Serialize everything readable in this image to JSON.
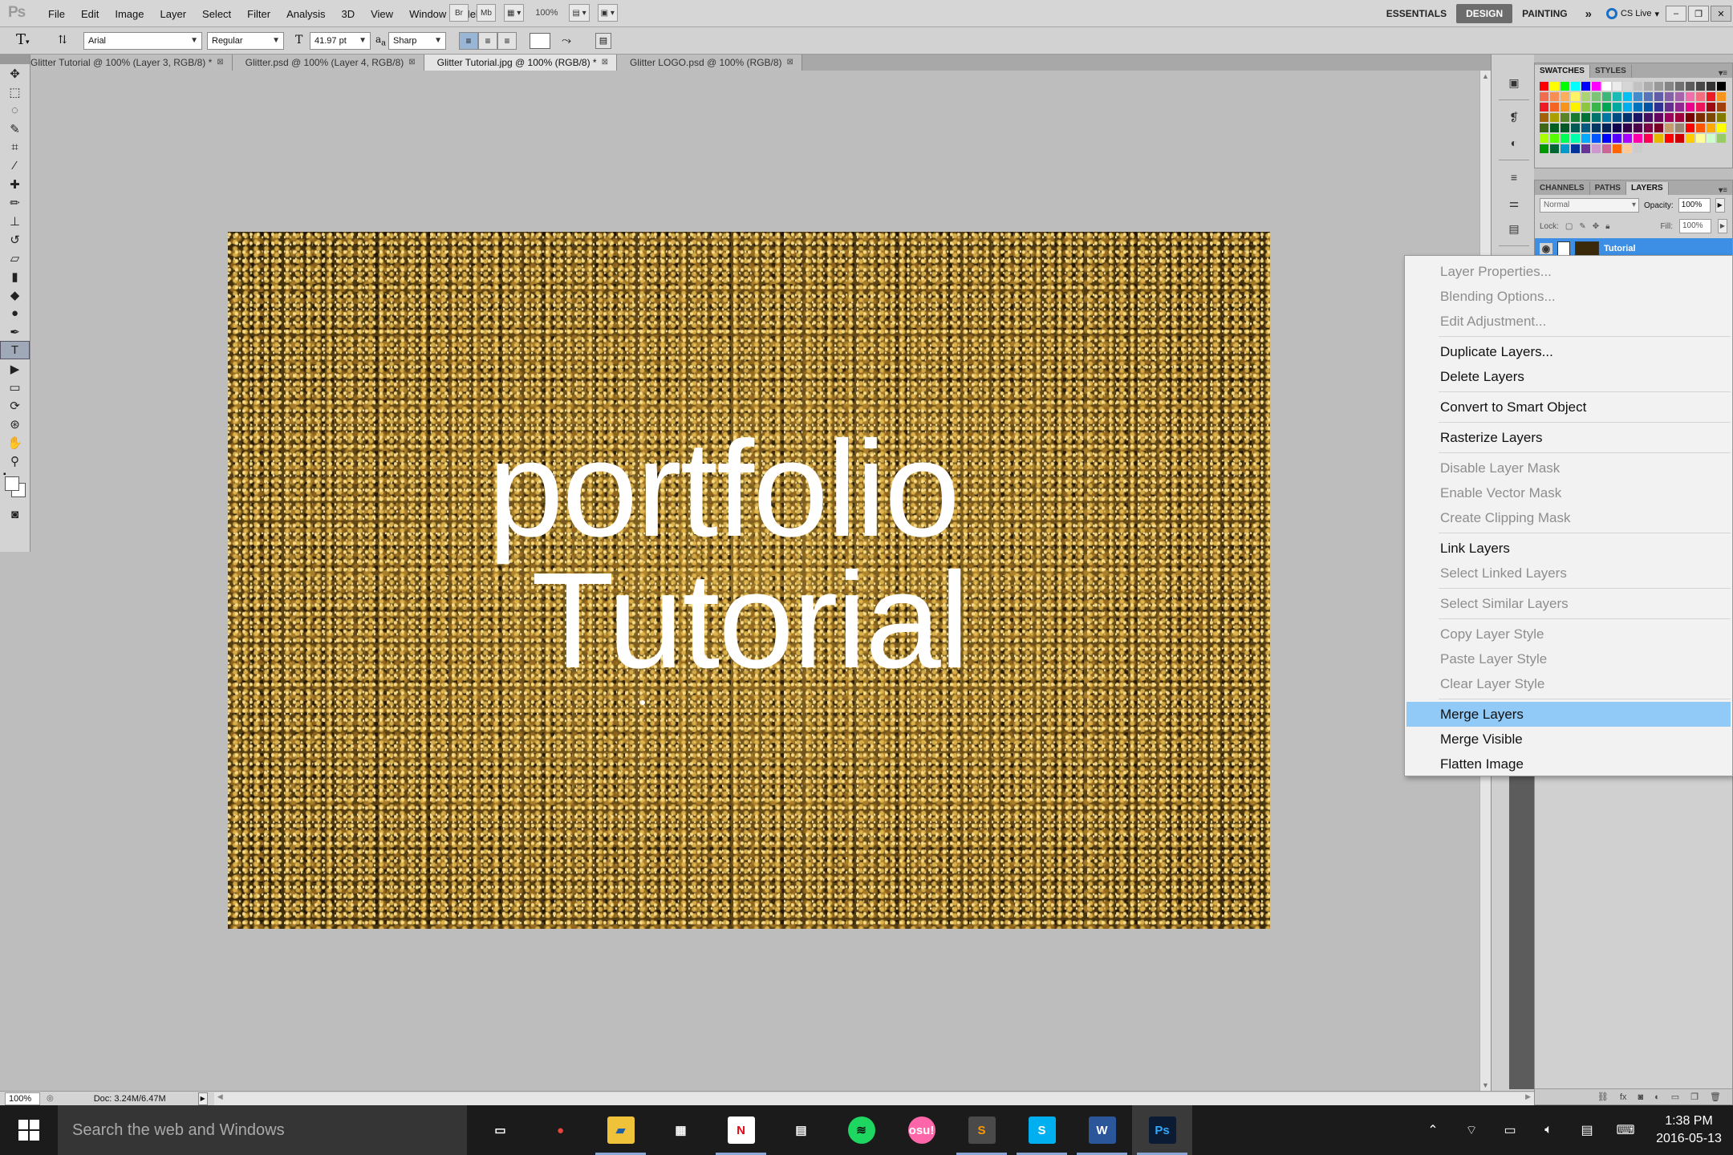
{
  "app": {
    "logo": "Ps",
    "menu": [
      "File",
      "Edit",
      "Image",
      "Layer",
      "Select",
      "Filter",
      "Analysis",
      "3D",
      "View",
      "Window",
      "Help"
    ],
    "toolbar_zoom": "100%",
    "workspaces": [
      "ESSENTIALS",
      "DESIGN",
      "PAINTING"
    ],
    "active_workspace": "DESIGN",
    "cslive": "CS Live"
  },
  "options": {
    "font_family": "Arial",
    "font_style": "Regular",
    "font_size": "41.97 pt",
    "aa_label": "a",
    "antialias": "Sharp"
  },
  "tabs": [
    {
      "label": "Glitter Tutorial  @ 100% (Layer 3, RGB/8) *",
      "active": false
    },
    {
      "label": "Glitter.psd @ 100% (Layer 4, RGB/8)",
      "active": false
    },
    {
      "label": "Glitter Tutorial.jpg @ 100% (RGB/8) *",
      "active": true
    },
    {
      "label": "Glitter LOGO.psd @ 100% (RGB/8)",
      "active": false
    }
  ],
  "canvas": {
    "line1": "portfolio",
    "line2": "Tutorial"
  },
  "panels": {
    "swatches_tabs": [
      "SWATCHES",
      "STYLES"
    ],
    "layers_tabs": [
      "CHANNELS",
      "PATHS",
      "LAYERS"
    ],
    "blend_mode": "Normal",
    "opacity_label": "Opacity:",
    "opacity": "100%",
    "lock_label": "Lock:",
    "fill_label": "Fill:",
    "fill": "100%",
    "layer_name": "Tutorial"
  },
  "swatch_colors": [
    "#ff0000",
    "#ffff00",
    "#00ff00",
    "#00ffff",
    "#0000ff",
    "#ff00ff",
    "#ffffff",
    "#ebebeb",
    "#d6d6d6",
    "#c2c2c2",
    "#adadad",
    "#999999",
    "#858585",
    "#707070",
    "#5c5c5c",
    "#474747",
    "#333333",
    "#000000",
    "#f26c4f",
    "#f68e55",
    "#fbaf5c",
    "#fff467",
    "#acd372",
    "#7cc576",
    "#3bb878",
    "#1abbb4",
    "#00bff3",
    "#438ccb",
    "#5574b9",
    "#605ca8",
    "#855fa8",
    "#a763a9",
    "#f06ea9",
    "#f26d7d",
    "#ed1c24",
    "#f7941d",
    "#ed1c24",
    "#f26522",
    "#f7941d",
    "#fff200",
    "#8dc63f",
    "#39b54a",
    "#00a651",
    "#00a99d",
    "#00aeef",
    "#0072bc",
    "#0054a6",
    "#2e3192",
    "#662d91",
    "#92278f",
    "#ec008c",
    "#ed145b",
    "#9e0b0f",
    "#a0410d",
    "#a3620a",
    "#aba000",
    "#598527",
    "#1a7b30",
    "#007236",
    "#00746b",
    "#0076a3",
    "#004b80",
    "#003471",
    "#1b1464",
    "#440e62",
    "#630460",
    "#9e005d",
    "#9e0039",
    "#790000",
    "#7b2e00",
    "#7d4900",
    "#827b00",
    "#406618",
    "#005e20",
    "#005826",
    "#005952",
    "#005b7f",
    "#003663",
    "#002157",
    "#0d004c",
    "#32004b",
    "#4b0049",
    "#7b0046",
    "#7a0026",
    "#c69c6d",
    "#998675",
    "#ff0000",
    "#ff5500",
    "#ffaa00",
    "#ffff00",
    "#aaff00",
    "#55ff00",
    "#00ff55",
    "#00ffaa",
    "#00aaff",
    "#0055ff",
    "#0000ff",
    "#5500ff",
    "#aa00ff",
    "#ff00aa",
    "#ff0055",
    "#e6b800",
    "#ff0000",
    "#cc0000",
    "#ffcc00",
    "#ffff99",
    "#ccffcc",
    "#99cc66",
    "#009900",
    "#006633",
    "#0099cc",
    "#003399",
    "#663399",
    "#cc99cc",
    "#cc6699",
    "#ff6600",
    "#ffcc99",
    "#cccccc"
  ],
  "context_menu": [
    {
      "label": "Layer Properties...",
      "state": "disabled"
    },
    {
      "label": "Blending Options...",
      "state": "disabled"
    },
    {
      "label": "Edit Adjustment...",
      "state": "disabled"
    },
    {
      "sep": true
    },
    {
      "label": "Duplicate Layers...",
      "state": "enabled"
    },
    {
      "label": "Delete Layers",
      "state": "enabled"
    },
    {
      "sep": true
    },
    {
      "label": "Convert to Smart Object",
      "state": "enabled"
    },
    {
      "sep": true
    },
    {
      "label": "Rasterize Layers",
      "state": "enabled"
    },
    {
      "sep": true
    },
    {
      "label": "Disable Layer Mask",
      "state": "disabled"
    },
    {
      "label": "Enable Vector Mask",
      "state": "disabled"
    },
    {
      "label": "Create Clipping Mask",
      "state": "disabled"
    },
    {
      "sep": true
    },
    {
      "label": "Link Layers",
      "state": "enabled"
    },
    {
      "label": "Select Linked Layers",
      "state": "disabled"
    },
    {
      "sep": true
    },
    {
      "label": "Select Similar Layers",
      "state": "disabled"
    },
    {
      "sep": true
    },
    {
      "label": "Copy Layer Style",
      "state": "disabled"
    },
    {
      "label": "Paste Layer Style",
      "state": "disabled"
    },
    {
      "label": "Clear Layer Style",
      "state": "disabled"
    },
    {
      "sep": true
    },
    {
      "label": "Merge Layers",
      "state": "highlighted"
    },
    {
      "label": "Merge Visible",
      "state": "enabled"
    },
    {
      "label": "Flatten Image",
      "state": "enabled"
    }
  ],
  "status": {
    "zoom": "100%",
    "doc": "Doc: 3.24M/6.47M"
  },
  "taskbar": {
    "search_placeholder": "Search the web and Windows",
    "time": "1:38 PM",
    "date": "2016-05-13",
    "apps": [
      {
        "name": "task-view",
        "glyph": "▭",
        "bg": "transparent",
        "fg": "#ffffff"
      },
      {
        "name": "chrome",
        "glyph": "●",
        "bg": "transparent",
        "fg": "#e8453c"
      },
      {
        "name": "file-explorer",
        "glyph": "▰",
        "bg": "#f0c239",
        "fg": "#1f5fa8"
      },
      {
        "name": "calendar",
        "glyph": "▦",
        "bg": "transparent",
        "fg": "#ffffff"
      },
      {
        "name": "netflix",
        "glyph": "N",
        "bg": "#ffffff",
        "fg": "#e50914"
      },
      {
        "name": "store",
        "glyph": "▤",
        "bg": "transparent",
        "fg": "#ffffff"
      },
      {
        "name": "spotify",
        "glyph": "≋",
        "bg": "#1ed760",
        "fg": "#111111"
      },
      {
        "name": "osu",
        "glyph": "osu!",
        "bg": "#ff66aa",
        "fg": "#ffffff"
      },
      {
        "name": "sublime",
        "glyph": "S",
        "bg": "#4a4a4a",
        "fg": "#ff9800"
      },
      {
        "name": "skype",
        "glyph": "S",
        "bg": "#00aff0",
        "fg": "#ffffff"
      },
      {
        "name": "word",
        "glyph": "W",
        "bg": "#2b579a",
        "fg": "#ffffff"
      },
      {
        "name": "photoshop",
        "glyph": "Ps",
        "bg": "#0b1b33",
        "fg": "#31a8ff"
      }
    ]
  }
}
